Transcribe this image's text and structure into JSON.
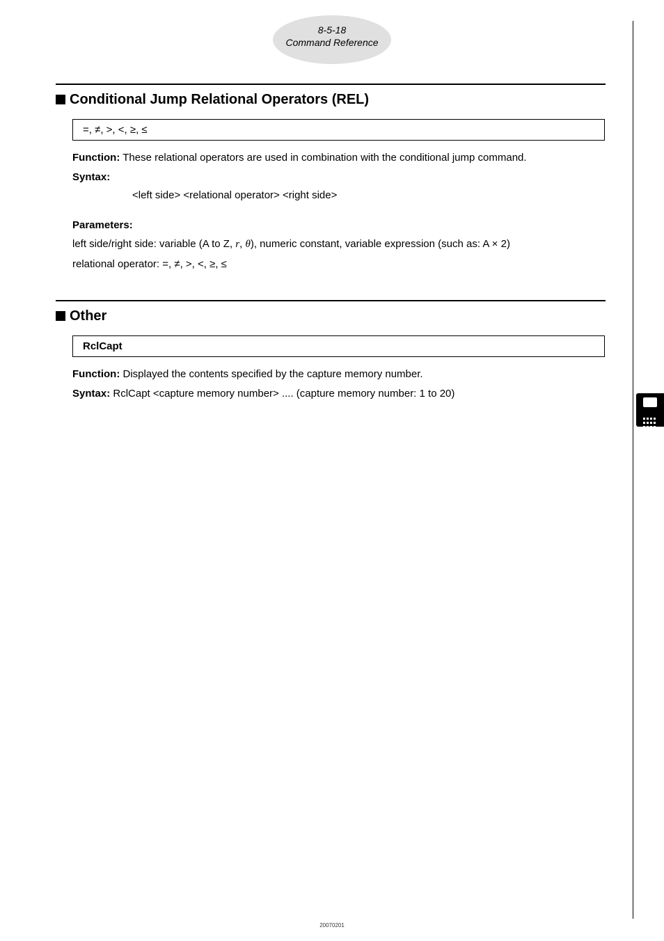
{
  "header": {
    "page_ref": "8-5-18",
    "title": "Command Reference"
  },
  "section1": {
    "heading": "Conditional Jump Relational Operators (REL)",
    "operators_line": "=, ≠, >, <, ≥, ≤",
    "func_label": "Function:",
    "func_text": " These relational operators are used in combination with the conditional jump command.",
    "syntax_label": "Syntax:",
    "syntax_line": "<left side> <relational operator> <right side>",
    "params_label": "Parameters:",
    "params_text_pre": "left side/right side: variable (A to Z, ",
    "params_var_r": "r",
    "params_sep": ", ",
    "params_var_theta": "θ",
    "params_text_post": "), numeric constant, variable expression (such as: A × 2)",
    "rel_op_line": "relational operator: =, ≠, >, <, ≥, ≤"
  },
  "section2": {
    "heading": "Other",
    "cmd_name": "RclCapt",
    "func_label": "Function:",
    "func_text": " Displayed the contents specified by the capture memory number.",
    "syntax_label": "Syntax:",
    "syntax_text": " RclCapt <capture memory number> .... (capture memory number: 1 to 20)"
  },
  "footer": {
    "code": "20070201"
  }
}
